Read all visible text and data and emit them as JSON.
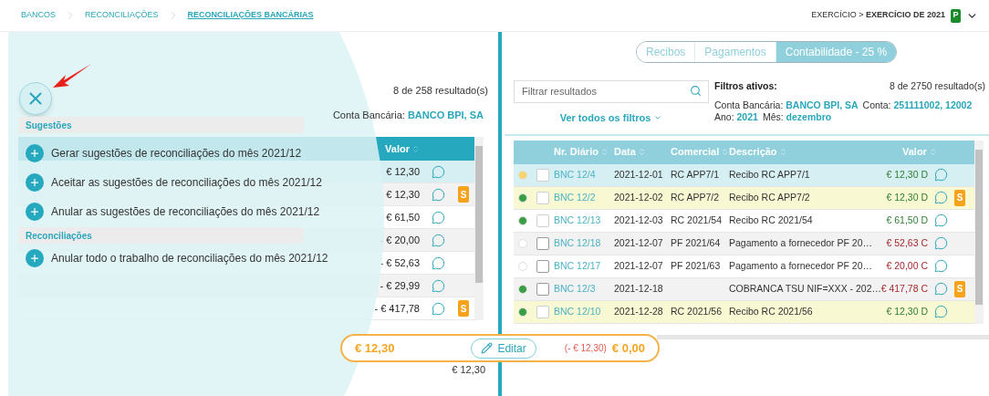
{
  "breadcrumbs": [
    {
      "label": "BANCOS",
      "current": false
    },
    {
      "label": "RECONCILIAÇÕES",
      "current": false
    },
    {
      "label": "RECONCILIAÇÕES BANCÁRIAS",
      "current": true
    }
  ],
  "exercise": {
    "text": "EXERCÍCIO > **EXERCÍCIO DE 2021**",
    "badge": "P"
  },
  "left": {
    "results": "8 de 258 resultado(s)",
    "filters": [
      {
        "label": "Conta Bancária:",
        "value": "BANCO BPI, SA"
      }
    ],
    "columns": [
      "Valor"
    ],
    "rows": [
      {
        "value": "€ 12,30",
        "selected": true,
        "badge": null
      },
      {
        "value": "€ 12,30",
        "selected": false,
        "badge": "S"
      },
      {
        "value": "€ 61,50",
        "selected": false,
        "badge": null
      },
      {
        "value": "- € 20,00",
        "selected": false,
        "badge": null
      },
      {
        "value": "- € 52,63",
        "selected": false,
        "badge": null
      },
      {
        "value": "- € 29,99",
        "selected": false,
        "badge": null
      },
      {
        "value": "- € 417,78",
        "selected": false,
        "badge": "S"
      }
    ],
    "picked": {
      "value": "€ 12,30"
    }
  },
  "menu": {
    "sections": [
      {
        "title": "Sugestões",
        "items": [
          "Gerar sugestões de reconciliações do mês 2021/12",
          "Aceitar as sugestões de reconciliações do mês 2021/12",
          "Anular as sugestões de reconciliações do mês 2021/12"
        ]
      },
      {
        "title": "Reconciliações",
        "items": [
          "Anular todo o trabalho de reconciliações do mês 2021/12"
        ]
      }
    ]
  },
  "right": {
    "tabs": [
      {
        "label": "Recibos",
        "selected": false
      },
      {
        "label": "Pagamentos",
        "selected": false
      },
      {
        "label": "Contabilidade - 25 %",
        "selected": true
      }
    ],
    "search": {
      "placeholder": "Filtrar resultados"
    },
    "see_all_filters": "Ver todos os filtros",
    "active_filters_title": "Filtros ativos:",
    "results": "8 de 2750 resultado(s)",
    "filter_lines": [
      [
        {
          "label": "Conta Bancária:",
          "value": "BANCO BPI, SA"
        },
        {
          "label": "Conta:",
          "value": "251111002, 12002"
        }
      ],
      [
        {
          "label": "Ano:",
          "value": "2021"
        },
        {
          "label": "Mês:",
          "value": "dezembro"
        }
      ]
    ],
    "columns": [
      "Nr. Diário",
      "Data",
      "Comercial",
      "Descrição",
      "Valor"
    ],
    "rows": [
      {
        "color": "#f7d36b",
        "checked": false,
        "journal": "BNC 12/4",
        "date": "2021-12-01",
        "commercial": "RC APP7/1",
        "description": "Recibo RC APP7/1",
        "value": "€ 12,30 D",
        "kind": "debit",
        "selected": true,
        "matched": false,
        "badge": null
      },
      {
        "color": "#3a9e44",
        "checked": false,
        "journal": "BNC 12/2",
        "date": "2021-12-02",
        "commercial": "RC APP7/2",
        "description": "Recibo RC APP7/2",
        "value": "€ 12,30 D",
        "kind": "debit",
        "selected": false,
        "matched": true,
        "badge": "S"
      },
      {
        "color": "#3a9e44",
        "checked": false,
        "journal": "BNC 12/13",
        "date": "2021-12-03",
        "commercial": "RC 2021/54",
        "description": "Recibo RC 2021/54",
        "value": "€ 61,50 D",
        "kind": "debit",
        "selected": false,
        "matched": false,
        "badge": null
      },
      {
        "color": "#ffffff",
        "checked": false,
        "journal": "BNC 12/18",
        "date": "2021-12-07",
        "commercial": "PF 2021/64",
        "description": "Pagamento a fornecedor PF 20…",
        "value": "€ 52,63 C",
        "kind": "credit",
        "selected": false,
        "matched": false,
        "badge": null
      },
      {
        "color": "#ffffff",
        "checked": false,
        "journal": "BNC 12/17",
        "date": "2021-12-07",
        "commercial": "PF 2021/63",
        "description": "Pagamento a fornecedor PF 20…",
        "value": "€ 20,00 C",
        "kind": "credit",
        "selected": false,
        "matched": false,
        "badge": null
      },
      {
        "color": "#3a9e44",
        "checked": false,
        "journal": "BNC 12/3",
        "date": "2021-12-18",
        "description": "COBRANCA TSU NIF=XXX - 202…",
        "value": "€ 417,78 C",
        "kind": "credit",
        "selected": false,
        "matched": false,
        "badge": "S"
      },
      {
        "color": "#3a9e44",
        "checked": false,
        "journal": "BNC 12/10",
        "date": "2021-12-28",
        "commercial": "RC 2021/56",
        "description": "Recibo RC 2021/56",
        "value": "€ 12,30 D",
        "kind": "debit",
        "selected": false,
        "matched": true,
        "badge": null
      }
    ]
  },
  "balance_bar": {
    "left_amount": "€ 12,30",
    "edit_button": "Editar",
    "difference": "(- € 12,30)",
    "total": "€ 0,00"
  }
}
